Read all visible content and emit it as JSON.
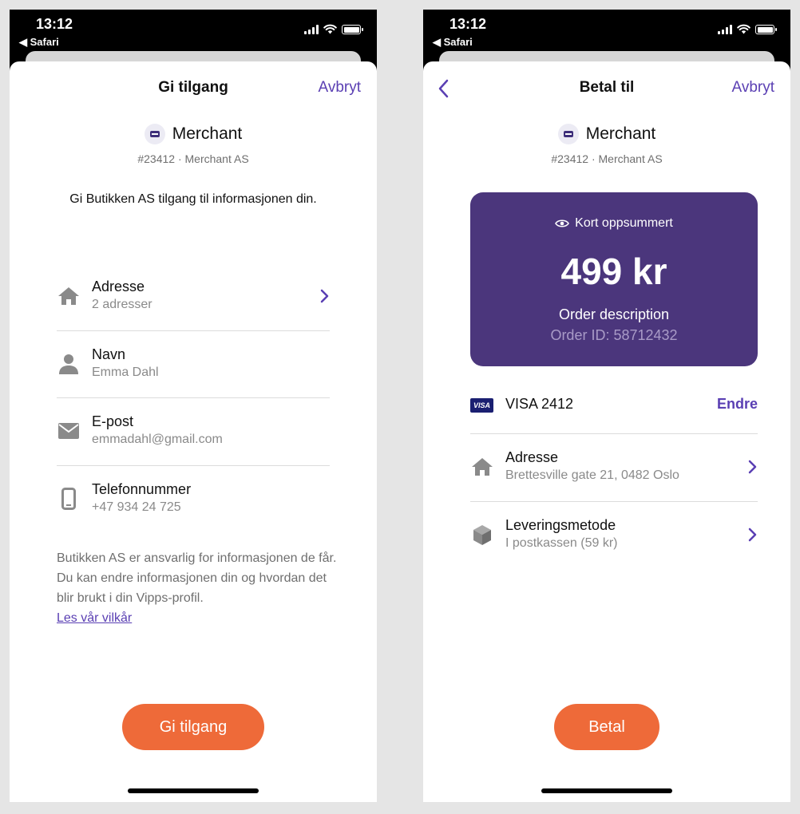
{
  "status_bar": {
    "time": "13:12",
    "back_app": "◀ Safari"
  },
  "left": {
    "title": "Gi tilgang",
    "cancel": "Avbryt",
    "merchant": {
      "name": "Merchant",
      "sub": "#23412 · Merchant AS"
    },
    "intro": "Gi Butikken AS tilgang til informasjonen din.",
    "items": [
      {
        "title": "Adresse",
        "sub": "2 adresser",
        "icon": "home-icon"
      },
      {
        "title": "Navn",
        "sub": "Emma Dahl",
        "icon": "person-icon"
      },
      {
        "title": "E-post",
        "sub": "emmadahl@gmail.com",
        "icon": "mail-icon"
      },
      {
        "title": "Telefonnummer",
        "sub": "+47 934 24 725",
        "icon": "phone-icon"
      }
    ],
    "disclaimer": "Butikken AS er ansvarlig for informasjonen de får. Du kan endre informasjonen din og hvordan det blir brukt i din Vipps-profil.",
    "terms_link": "Les vår vilkår",
    "cta": "Gi tilgang"
  },
  "right": {
    "title": "Betal til",
    "cancel": "Avbryt",
    "merchant": {
      "name": "Merchant",
      "sub": "#23412 · Merchant AS"
    },
    "summary": {
      "label": "Kort oppsummert",
      "amount": "499 kr",
      "description": "Order description",
      "order_id": "Order ID: 58712432"
    },
    "card": {
      "brand": "VISA",
      "label": "VISA 2412",
      "change": "Endre"
    },
    "items": [
      {
        "title": "Adresse",
        "sub": "Brettesville gate 21, 0482 Oslo",
        "icon": "home-icon"
      },
      {
        "title": "Leveringsmetode",
        "sub": "I postkassen (59 kr)",
        "icon": "package-icon"
      }
    ],
    "cta": "Betal"
  },
  "colors": {
    "accent": "#5a3fb3",
    "cta": "#ee6a39",
    "summary_card": "#4b367c",
    "icon_gray": "#8a8a8a"
  }
}
